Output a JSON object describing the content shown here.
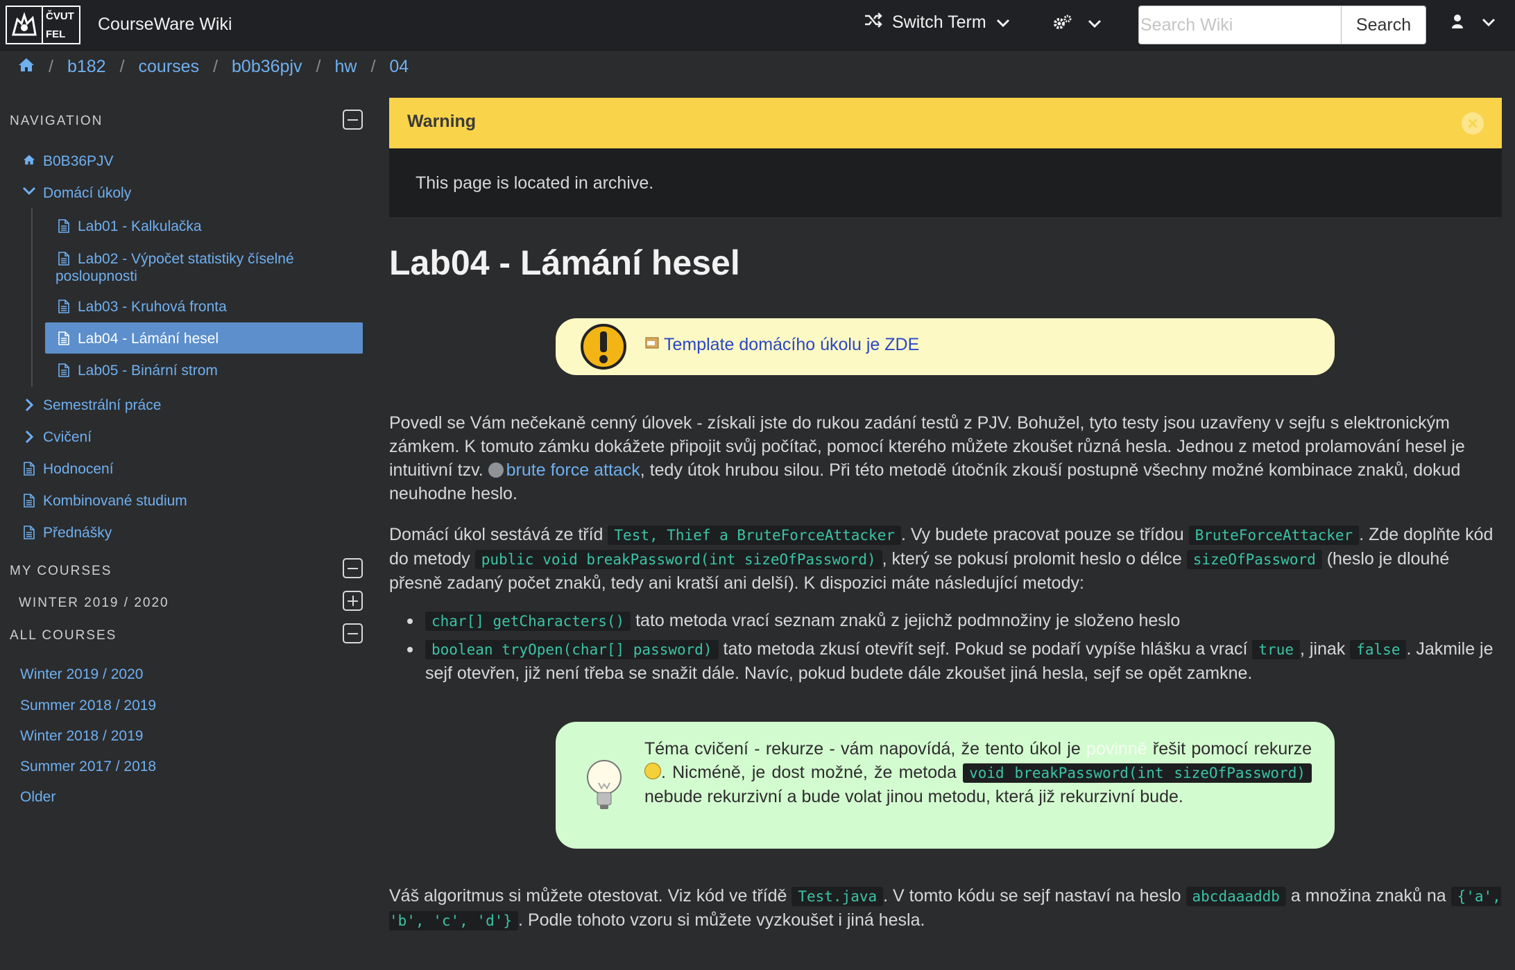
{
  "header": {
    "logo_text_top": "ČVUT",
    "logo_text_bottom": "FEL",
    "brand": "CourseWare Wiki",
    "switch_term": "Switch Term",
    "search_placeholder": "Search Wiki",
    "search_button": "Search"
  },
  "breadcrumb": [
    "b182",
    "courses",
    "b0b36pjv",
    "hw",
    "04"
  ],
  "sidebar": {
    "navigation_title": "NAVIGATION",
    "root": "B0B36PJV",
    "folder": "Domácí úkoly",
    "children": [
      "Lab01 - Kalkulačka",
      "Lab02 - Výpočet statistiky číselné",
      "posloupnosti",
      "Lab03 - Kruhová fronta",
      "Lab04 - Lámání hesel",
      "Lab05 - Binární strom"
    ],
    "items": [
      "Semestrální práce",
      "Cvičení",
      "Hodnocení",
      "Kombinované studium",
      "Přednášky"
    ],
    "my_courses_title": "MY COURSES",
    "my_courses_term": "WINTER 2019 / 2020",
    "all_courses_title": "ALL COURSES",
    "all_courses": [
      "Winter 2019 / 2020",
      "Summer 2018 / 2019",
      "Winter 2018 / 2019",
      "Summer 2017 / 2018",
      "Older"
    ]
  },
  "warning": {
    "title": "Warning",
    "close": "×",
    "text": "This page is located in archive."
  },
  "page": {
    "title": "Lab04 - Lámání hesel",
    "template_link": "Template domácího úkolu je ZDE",
    "p1_a": "Povedl se Vám nečekaně cenný úlovek - získali jste do rukou zadání testů z PJV. Bohužel, tyto testy jsou uzavřeny v sejfu s elektronickým zámkem. K tomuto zámku dokážete připojit svůj počítač, pomocí kterého můžete zkoušet různá hesla. Jednou z metod prolamování hesel je intuitivní tzv. ",
    "p1_link": "brute force attack",
    "p1_b": ", tedy útok hrubou silou. Při této metodě útočník zkouší postupně všechny možné kombinace znaků, dokud neuhodne heslo.",
    "p2_a": "Domácí úkol sestává ze tříd ",
    "p2_code1": "Test, Thief a BruteForceAttacker",
    "p2_b": ". Vy budete pracovat pouze se třídou ",
    "p2_code2": "BruteForceAttacker",
    "p2_c": ". Zde doplňte kód do metody ",
    "p2_code3": "public void breakPassword(int sizeOfPassword)",
    "p2_d": ", který se pokusí prolomit heslo o délce ",
    "p2_code4": "sizeOfPassword",
    "p2_e": " (heslo je dlouhé přesně zadaný počet znaků, tedy ani kratší ani delší). K dispozici máte následující metody:",
    "b1_code": "char[] getCharacters()",
    "b1_text": " tato metoda vrací seznam znaků z jejichž podmnožiny je složeno heslo",
    "b2_code": "boolean tryOpen(char[] password)",
    "b2_a": " tato metoda zkusí otevřít sejf. Pokud se podaří vypíše hlášku a vrací ",
    "b2_true": "true",
    "b2_b": ", jinak ",
    "b2_false": "false",
    "b2_c": ". Jakmile je sejf otevřen, již není třeba se snažit dále. Navíc, pokud budete dále zkoušet jiná hesla, sejf se opět zamkne.",
    "tip_a": "Téma cvičení - rekurze - vám napovídá, že tento úkol je ",
    "tip_hidden": "povinně",
    "tip_b": " řešit pomocí rekurze ",
    "tip_c": ". Nicméně, je dost možné, že metoda ",
    "tip_code": "void breakPassword(int sizeOfPassword)",
    "tip_d": " nebude rekurzivní a bude volat jinou metodu, která již rekurzivní bude.",
    "p3_a": "Váš algoritmus si můžete otestovat. Viz kód ve třídě ",
    "p3_code1": "Test.java",
    "p3_b": ". V tomto kódu se sejf nastaví na heslo ",
    "p3_code2": "abcdaaaddb",
    "p3_c": " a množina znaků na ",
    "p3_code3": "{'a', 'b', 'c', 'd'}",
    "p3_d": ". Podle tohoto vzoru si můžete vyzkoušet i jiná hesla."
  },
  "colors": {
    "topbar": "#1f2124",
    "background": "#2b2c2e",
    "link": "#6fb0f0",
    "active_nav": "#5c8fcb",
    "warning": "#f9d34a",
    "code": "#3bc4a6"
  },
  "icons": [
    "home-icon",
    "shuffle-icon",
    "gears-icon",
    "user-icon",
    "chevron-down-icon",
    "document-icon",
    "chevron-right-icon",
    "warning-icon",
    "zip-icon",
    "globe-icon",
    "lightbulb-icon",
    "smiley-icon"
  ]
}
